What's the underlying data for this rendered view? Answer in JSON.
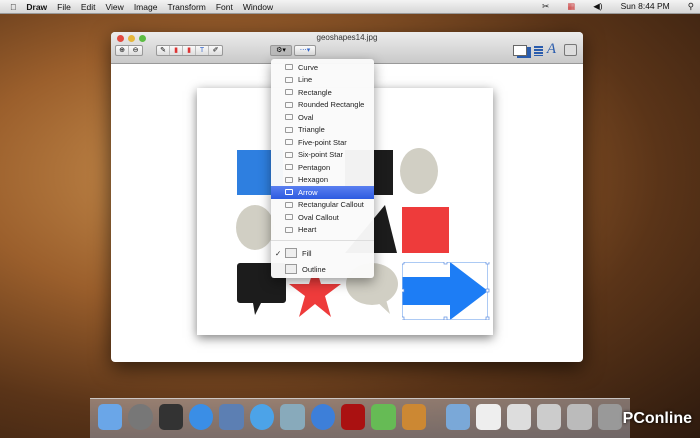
{
  "menubar": {
    "apple": "",
    "app": "Draw",
    "items": [
      "File",
      "Edit",
      "View",
      "Image",
      "Transform",
      "Font",
      "Window"
    ],
    "clock": "Sun 8:44 PM"
  },
  "window": {
    "title": "geoshapes14.jpg"
  },
  "toolbar": {
    "groups": [
      [
        "⊕",
        "⊖"
      ],
      [
        "✎",
        "▮",
        "▮",
        "T",
        "✐"
      ],
      [
        "⚙▾"
      ],
      [
        "⋯▾"
      ]
    ]
  },
  "shape_menu": {
    "items": [
      "Curve",
      "Line",
      "Rectangle",
      "Rounded Rectangle",
      "Oval",
      "Triangle",
      "Five-point Star",
      "Six-point Star",
      "Pentagon",
      "Hexagon",
      "Arrow",
      "Rectangular Callout",
      "Oval Callout",
      "Heart"
    ],
    "selected": "Arrow",
    "fill_label": "Fill",
    "fill_checked": "✓",
    "outline_label": "Outline"
  },
  "colors": {
    "blue": "#2e7fe0",
    "gray": "#d1cfc4",
    "black": "#1c1c1c",
    "red": "#ee3b3b",
    "arrow": "#1d7df5",
    "highlight": "#3b66e6"
  },
  "watermark": "PConline"
}
